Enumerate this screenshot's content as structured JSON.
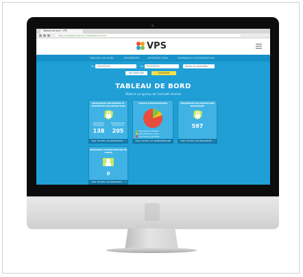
{
  "browser": {
    "tab_title": "Tableau de bord - VPS",
    "url": "https://vpsgate.vpsgroup.com/tableau-de-bord"
  },
  "site": {
    "brand": "VPS",
    "brand_colors": [
      "#e74c3c",
      "#f39c12",
      "#2e9dd6",
      "#7cc34a"
    ],
    "menu": [
      "TABLEAU DE BORD",
      "PROPRIÉTÉS",
      "INTERVENTIONS",
      "DEMANDES D'INTERVENTION"
    ]
  },
  "filters": {
    "date_label": "Du",
    "date_from": "01/01/2019",
    "date_to_label": "Au",
    "date_to": "31/12/2019",
    "select_value": "Toutes les propriétés",
    "search_button": "RECHERCHER",
    "export_button": "EXPORTER"
  },
  "dashboard": {
    "title": "TABLEAU DE BORD",
    "subtitle": "Obtenir un aperçu de l'activité récente",
    "cards": [
      {
        "heading": "PROPRIÉTÉS SÉCURISÉES ET PROPRIÉTÉS EN PROTECTION",
        "left_label": "PROPRIÉTÉS SÉCURISÉES",
        "left_value": "138",
        "right_label": "PROPRIÉTÉS EN PROTECTION",
        "right_value": "205",
        "footer": "VOIR TOUTES LES PROPRIÉTÉS"
      },
      {
        "heading": "STATUT D'INTERVENTION",
        "legend": [
          "Interventions réalisées",
          "Interventions en cours",
          "Interventions planifiées"
        ],
        "legend_colors": [
          "#7cc34a",
          "#f1c40f",
          "#e74c3c"
        ],
        "pie_shares": [
          0.12,
          0.08,
          0.8
        ],
        "footer": "VOIR TOUTES LES INTERVENTIONS"
      },
      {
        "heading": "PROPRIÉTÉS EN PROTECTION RENFORCÉE",
        "value": "597",
        "footer": "VOIR TOUTES LES PROPRIÉTÉS"
      },
      {
        "heading": "DEMANDES D'INTERVENTION EN COURS",
        "value": "0",
        "footer": "VOIR TOUTES LES DEMANDES"
      }
    ]
  }
}
